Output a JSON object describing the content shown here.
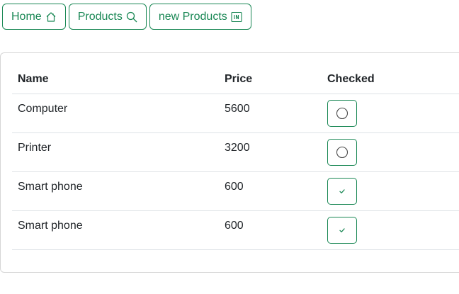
{
  "nav": {
    "buttons": [
      {
        "label": "Home",
        "icon": "house-icon"
      },
      {
        "label": "Products",
        "icon": "search-icon"
      },
      {
        "label": "new Products",
        "icon": "new-item-icon"
      }
    ]
  },
  "table": {
    "headers": {
      "name": "Name",
      "price": "Price",
      "checked": "Checked"
    },
    "rows": [
      {
        "name": "Computer",
        "price": "5600",
        "checked": false
      },
      {
        "name": "Printer",
        "price": "3200",
        "checked": false
      },
      {
        "name": "Smart phone",
        "price": "600",
        "checked": true
      },
      {
        "name": "Smart phone",
        "price": "600",
        "checked": true
      }
    ]
  },
  "colors": {
    "accent": "#198754",
    "border": "#d6d6d6",
    "divider": "#dee2e6"
  }
}
